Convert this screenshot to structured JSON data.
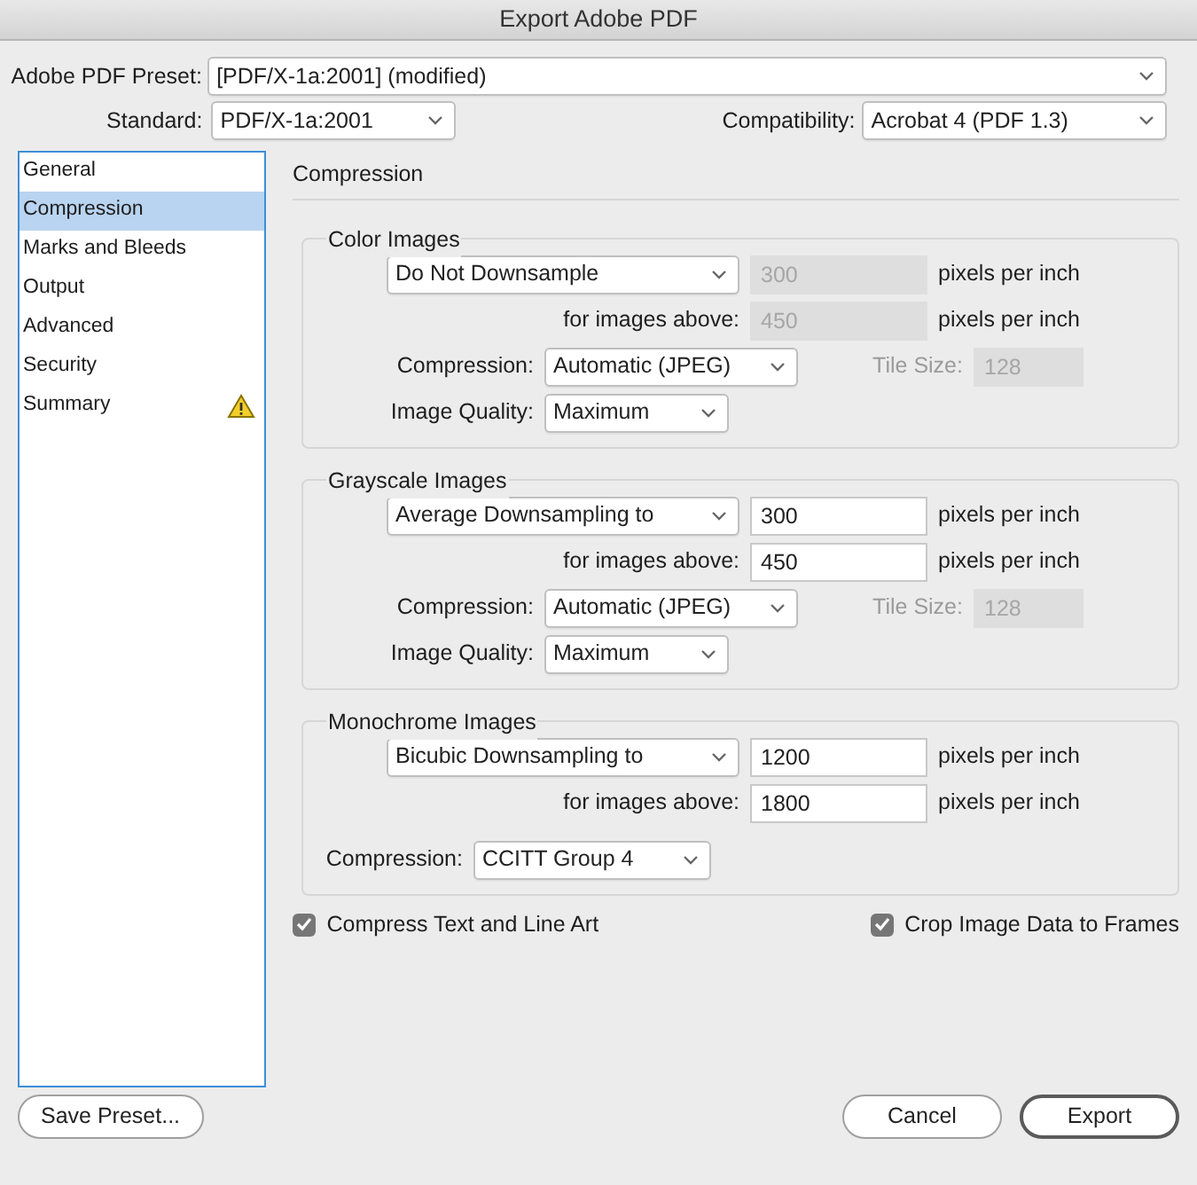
{
  "window": {
    "title": "Export Adobe PDF"
  },
  "preset": {
    "label": "Adobe PDF Preset:",
    "value": "[PDF/X-1a:2001] (modified)"
  },
  "standard": {
    "label": "Standard:",
    "value": "PDF/X-1a:2001"
  },
  "compatibility": {
    "label": "Compatibility:",
    "value": "Acrobat 4 (PDF 1.3)"
  },
  "sidebar": {
    "items": [
      {
        "label": "General",
        "selected": false,
        "warning": false
      },
      {
        "label": "Compression",
        "selected": true,
        "warning": false
      },
      {
        "label": "Marks and Bleeds",
        "selected": false,
        "warning": false
      },
      {
        "label": "Output",
        "selected": false,
        "warning": false
      },
      {
        "label": "Advanced",
        "selected": false,
        "warning": false
      },
      {
        "label": "Security",
        "selected": false,
        "warning": false
      },
      {
        "label": "Summary",
        "selected": false,
        "warning": true
      }
    ]
  },
  "section_title": "Compression",
  "groups": [
    {
      "kind": "full",
      "title": "Color Images",
      "method": "Do Not Downsample",
      "resolution": {
        "value": "300",
        "disabled": true
      },
      "resolution_unit": "pixels per inch",
      "threshold_label": "for images above:",
      "threshold": {
        "value": "450",
        "disabled": true
      },
      "threshold_unit": "pixels per inch",
      "compression_label": "Compression:",
      "compression": "Automatic (JPEG)",
      "tile_size": {
        "label": "Tile Size:",
        "value": "128",
        "disabled": true
      },
      "quality_label": "Image Quality:",
      "quality": "Maximum"
    },
    {
      "kind": "full",
      "title": "Grayscale Images",
      "method": "Average Downsampling to",
      "resolution": {
        "value": "300",
        "disabled": false
      },
      "resolution_unit": "pixels per inch",
      "threshold_label": "for images above:",
      "threshold": {
        "value": "450",
        "disabled": false
      },
      "threshold_unit": "pixels per inch",
      "compression_label": "Compression:",
      "compression": "Automatic (JPEG)",
      "tile_size": {
        "label": "Tile Size:",
        "value": "128",
        "disabled": true
      },
      "quality_label": "Image Quality:",
      "quality": "Maximum"
    },
    {
      "kind": "mono",
      "title": "Monochrome Images",
      "method": "Bicubic Downsampling to",
      "resolution": {
        "value": "1200",
        "disabled": false
      },
      "resolution_unit": "pixels per inch",
      "threshold_label": "for images above:",
      "threshold": {
        "value": "1800",
        "disabled": false
      },
      "threshold_unit": "pixels per inch",
      "compression_label": "Compression:",
      "compression": "CCITT Group 4"
    }
  ],
  "options": [
    {
      "label": "Compress Text and Line Art",
      "checked": true
    },
    {
      "label": "Crop Image Data to Frames",
      "checked": true
    }
  ],
  "buttons": [
    {
      "label": "Save Preset...",
      "default": false
    },
    {
      "label": "Cancel",
      "default": false
    },
    {
      "label": "Export",
      "default": true
    }
  ]
}
